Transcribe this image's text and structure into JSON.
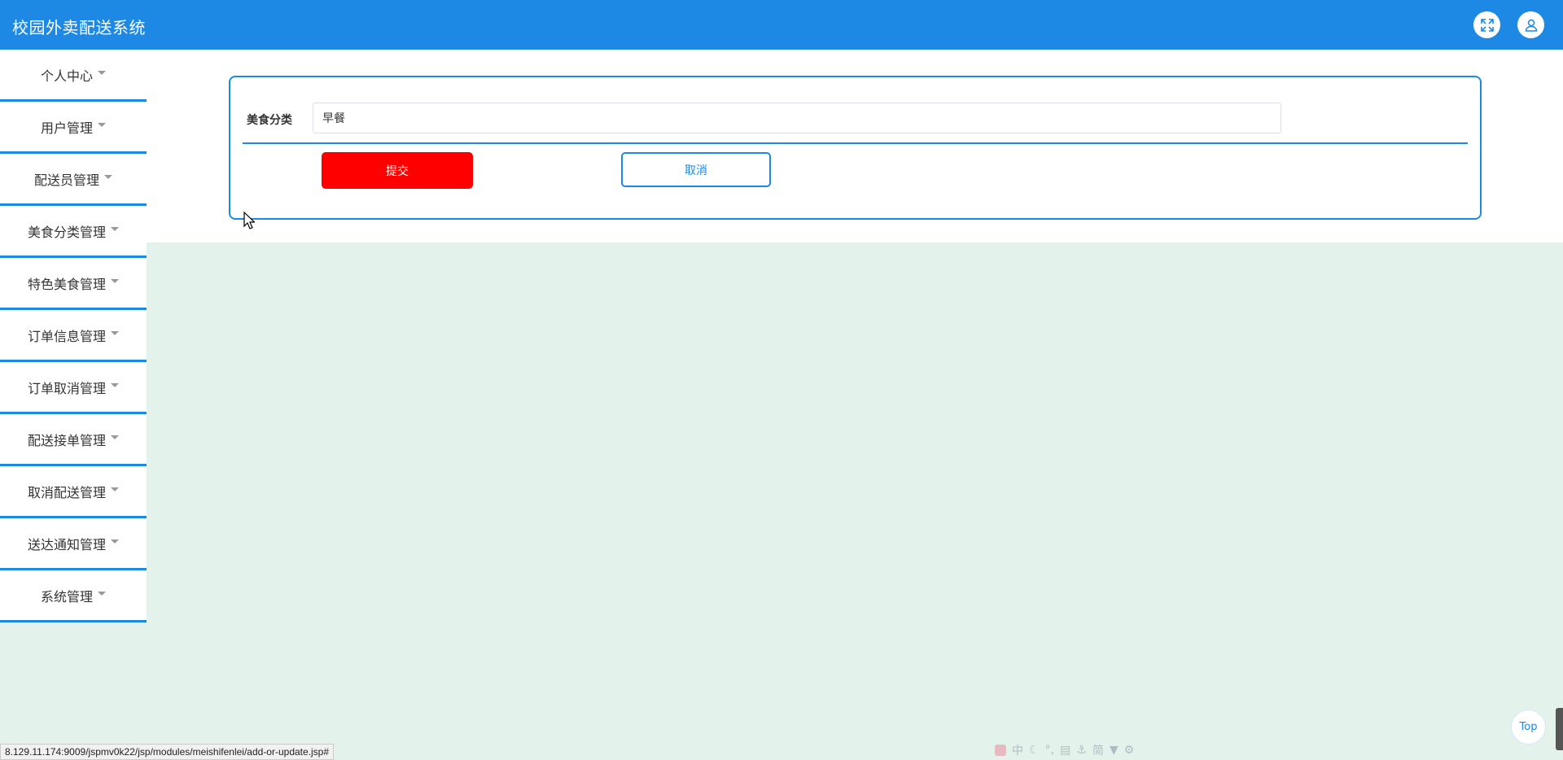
{
  "app": {
    "title": "校园外卖配送系统"
  },
  "header": {
    "fullscreen_icon": "fullscreen-icon",
    "user_icon": "user-icon"
  },
  "sidebar": {
    "items": [
      {
        "label": "个人中心"
      },
      {
        "label": "用户管理"
      },
      {
        "label": "配送员管理"
      },
      {
        "label": "美食分类管理"
      },
      {
        "label": "特色美食管理"
      },
      {
        "label": "订单信息管理"
      },
      {
        "label": "订单取消管理"
      },
      {
        "label": "配送接单管理"
      },
      {
        "label": "取消配送管理"
      },
      {
        "label": "送达通知管理"
      },
      {
        "label": "系统管理"
      }
    ]
  },
  "form": {
    "label": "美食分类",
    "value": "早餐",
    "submit_label": "提交",
    "cancel_label": "取消"
  },
  "top_button": {
    "label": "Top"
  },
  "status_bar": {
    "url": "8.129.11.174:9009/jspmv0k22/jsp/modules/meishifenlei/add-or-update.jsp#"
  },
  "ime": {
    "items": [
      "中",
      "简"
    ]
  },
  "colors": {
    "primary": "#1e88e5",
    "submit": "#ff0000",
    "background": "#e4f2ec"
  }
}
